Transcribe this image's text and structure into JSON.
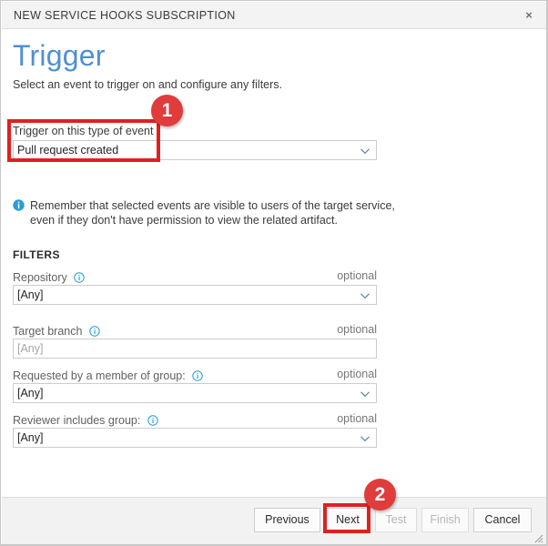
{
  "window": {
    "title": "NEW SERVICE HOOKS SUBSCRIPTION",
    "close_label": "×"
  },
  "page": {
    "title": "Trigger",
    "subtitle": "Select an event to trigger on and configure any filters.",
    "title_color": "#4f8fd4"
  },
  "trigger": {
    "label": "Trigger on this type of event",
    "value": "Pull request created",
    "chevron_icon": "chevron-down-icon"
  },
  "note": {
    "icon": "info-circle-filled-icon",
    "text": "Remember that selected events are visible to users of the target service, even if they don't have permission to view the related artifact."
  },
  "filters": {
    "heading": "FILTERS",
    "optional_label": "optional",
    "info_icon": "info-circle-outline-icon",
    "rows": [
      {
        "label": "Repository",
        "control": "select",
        "value": "[Any]",
        "optional": "optional"
      },
      {
        "label": "Target branch",
        "control": "text",
        "value": "",
        "placeholder": "[Any]",
        "optional": "optional"
      },
      {
        "label": "Requested by a member of group:",
        "control": "select",
        "value": "[Any]",
        "optional": "optional"
      },
      {
        "label": "Reviewer includes group:",
        "control": "select",
        "value": "[Any]",
        "optional": "optional"
      }
    ]
  },
  "footer": {
    "buttons": [
      {
        "label": "Previous",
        "disabled": false
      },
      {
        "label": "Next",
        "disabled": false
      },
      {
        "label": "Test",
        "disabled": true
      },
      {
        "label": "Finish",
        "disabled": true
      },
      {
        "label": "Cancel",
        "disabled": false
      }
    ],
    "resize_grip_icon": "resize-grip-icon"
  },
  "annotations": {
    "accent_color": "#e03c3c",
    "box_color": "#e02020",
    "badges": [
      {
        "number": "1"
      },
      {
        "number": "2"
      }
    ]
  }
}
